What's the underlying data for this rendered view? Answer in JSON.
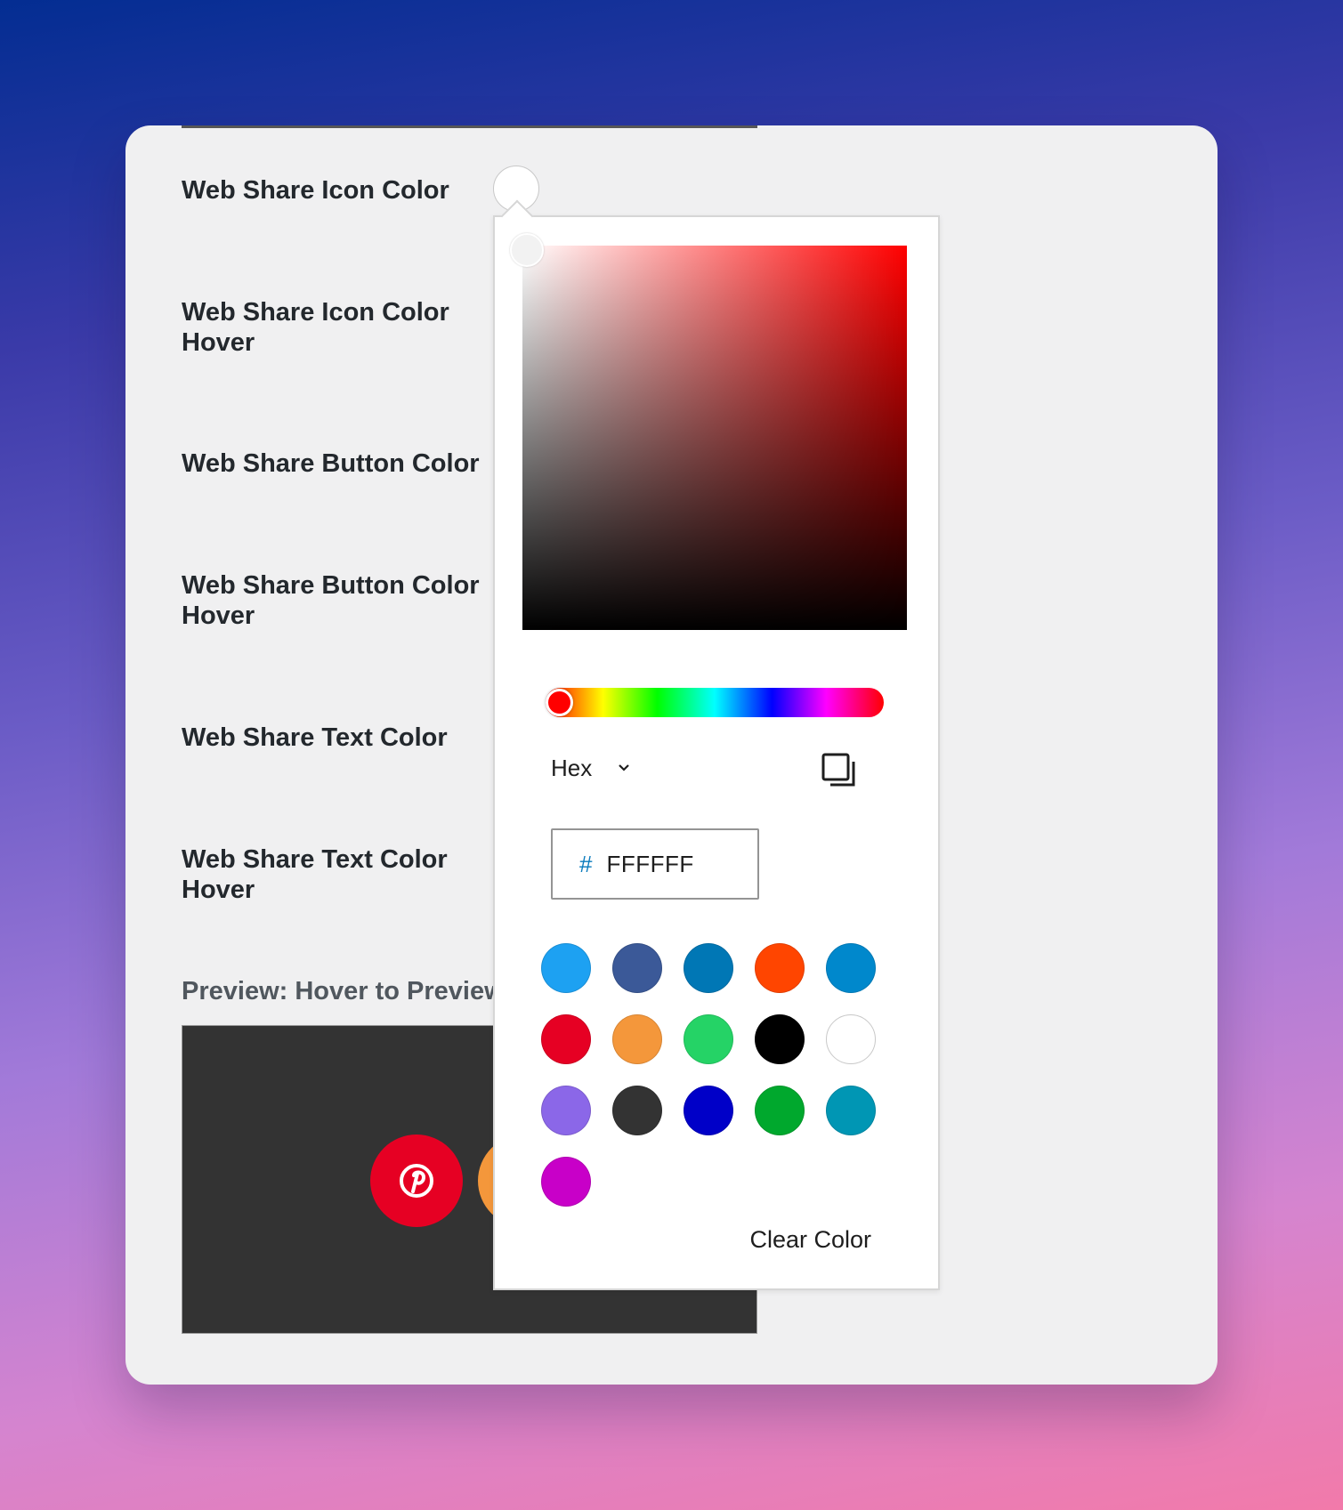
{
  "settings": {
    "labels": [
      "Web Share Icon Color",
      "Web Share Icon Color Hover",
      "Web Share Button Color",
      "Web Share Button Color Hover",
      "Web Share Text Color",
      "Web Share Text Color Hover"
    ],
    "preview_label": "Preview: Hover to Preview"
  },
  "preview": {
    "buttons": [
      {
        "name": "pinterest",
        "color": "#e60023",
        "icon": "pinterest-icon"
      },
      {
        "name": "orange",
        "color": "#f4973b"
      }
    ]
  },
  "picker": {
    "current_swatch": "#ffffff",
    "hue_color": "#ff0000",
    "format": "Hex",
    "hex_prefix": "#",
    "hex_value": "FFFFFF",
    "copy_icon": "copy-icon",
    "clear_label": "Clear Color",
    "palette": [
      "#1da1f2",
      "#3b5998",
      "#0077b5",
      "#ff4500",
      "#0088cc",
      "#e60023",
      "#f4973b",
      "#25d366",
      "#000000",
      "#ffffff",
      "#8b67e8",
      "#333333",
      "#0000c8",
      "#00a82d",
      "#0096b4",
      "#c800c8"
    ]
  }
}
